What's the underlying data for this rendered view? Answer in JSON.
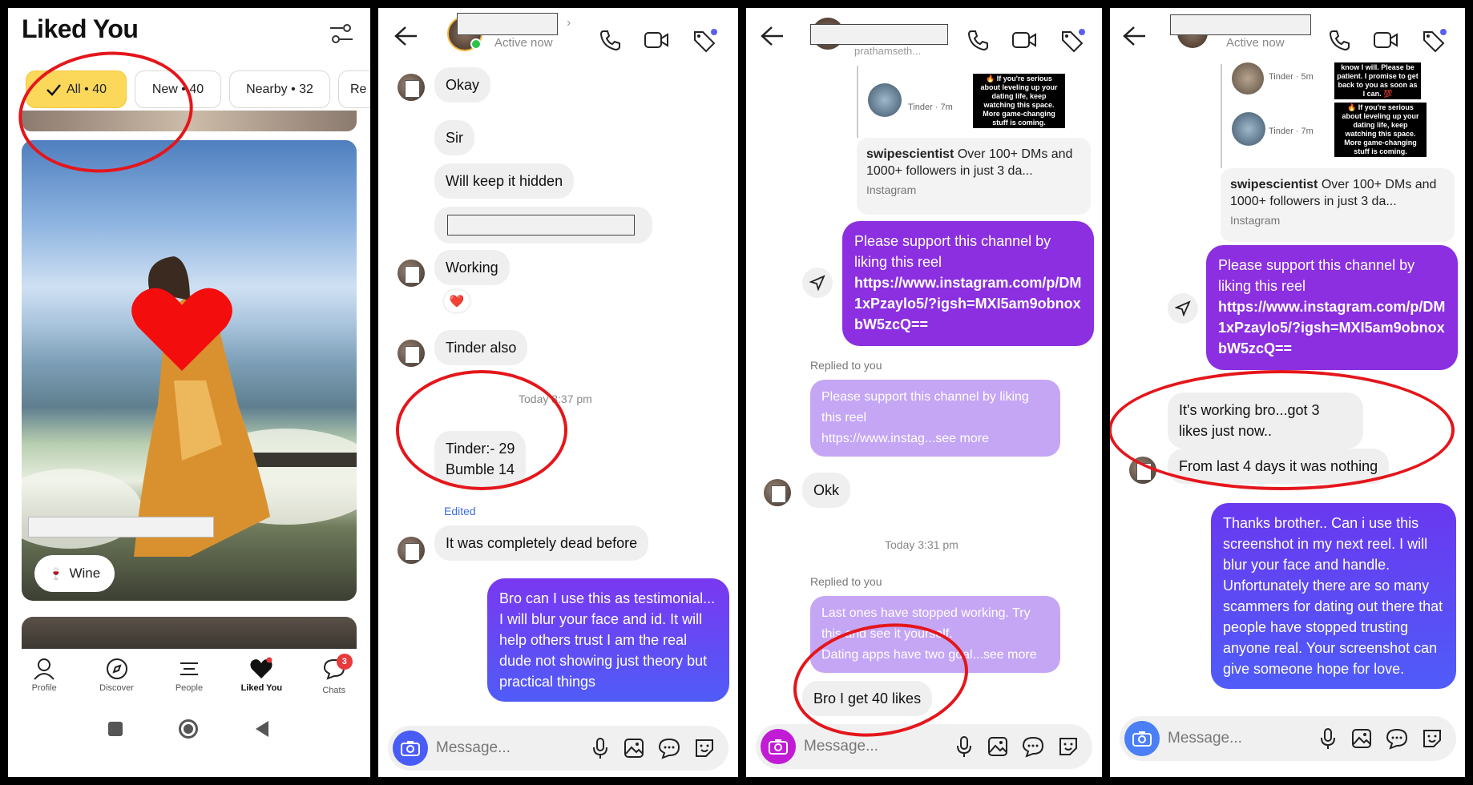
{
  "panel1": {
    "title": "Liked You",
    "filters": [
      {
        "label": "All • 40"
      },
      {
        "label": "New • 40"
      },
      {
        "label": "Nearby • 32"
      },
      {
        "label": "Re"
      }
    ],
    "card": {
      "interest": "Wine"
    },
    "nav": [
      {
        "label": "Profile"
      },
      {
        "label": "Discover"
      },
      {
        "label": "People"
      },
      {
        "label": "Liked You"
      },
      {
        "label": "Chats",
        "badge": "3"
      }
    ]
  },
  "panel2": {
    "header": {
      "status": "Active now"
    },
    "messages": {
      "m1": "Okay",
      "m2": "Sir",
      "m3": "Will keep it hidden",
      "m5": "Working",
      "reaction": "❤️",
      "m6": "Tinder also",
      "time": "Today 3:37 pm",
      "m7": "Tinder:- 29\nBumble 14",
      "edited": "Edited",
      "m8": "It was completely dead before",
      "out1": "Bro can I use this as testimonial... I will blur your face and id. It will help others trust I am the real dude not showing just theory but practical things"
    },
    "input_placeholder": "Message..."
  },
  "panel3": {
    "header": {
      "subtitle": "prathamseth..."
    },
    "thumb": {
      "source": "Tinder · 7m",
      "caption": "🔥 If you're serious about leveling up your dating life, keep watching this space. More game-changing stuff is coming."
    },
    "igcard": {
      "user": "swipescientist",
      "text": "Over 100+ DMs and 1000+ followers in just 3 da...",
      "source": "Instagram"
    },
    "out1": {
      "text": "Please support this channel by liking this reel",
      "link": "https://www.instagram.com/p/DM1xPzaylo5/?igsh=MXI5am9obnoxbW5zcQ=="
    },
    "replied1": "Replied to you",
    "quote1": "Please support this channel by liking this reel\nhttps://www.instag...see more",
    "in1": "Okk",
    "time": "Today 3:31 pm",
    "replied2": "Replied to you",
    "quote2": "Last ones have stopped working. Try this and see it yourself.\nDating apps have two goal...see more",
    "in2": "Bro I get 40 likes",
    "input_placeholder": "Message..."
  },
  "panel4": {
    "header": {
      "status": "Active now"
    },
    "thumb": {
      "source1": "Tinder · 5m",
      "caption1": "know I will. Please be patient. I promise to get back to you as soon as I can. 💯",
      "source2": "Tinder · 7m",
      "caption2": "🔥 If you're serious about leveling up your dating life, keep watching this space. More game-changing stuff is coming."
    },
    "igcard": {
      "user": "swipescientist",
      "text": "Over 100+ DMs and 1000+ followers in just 3 da...",
      "source": "Instagram"
    },
    "out1": {
      "text": "Please support this channel by liking this reel",
      "link": "https://www.instagram.com/p/DM1xPzaylo5/?igsh=MXI5am9obnoxbW5zcQ=="
    },
    "in1": "It's working bro...got 3 likes just now..",
    "in2": "From last 4 days it was nothing",
    "out2": "Thanks brother.. Can i use this screenshot in my next reel. I will blur your face and handle. Unfortunately there are so many scammers for dating out there that people have stopped trusting anyone real. Your screenshot can give someone hope for love.",
    "input_placeholder": "Message..."
  },
  "colors": {
    "accent_yellow": "#fbd85a",
    "outgoing_gradient": "#6a3df2",
    "purple_outgoing": "#8b2fe0",
    "annotation_red": "#e4161b"
  }
}
